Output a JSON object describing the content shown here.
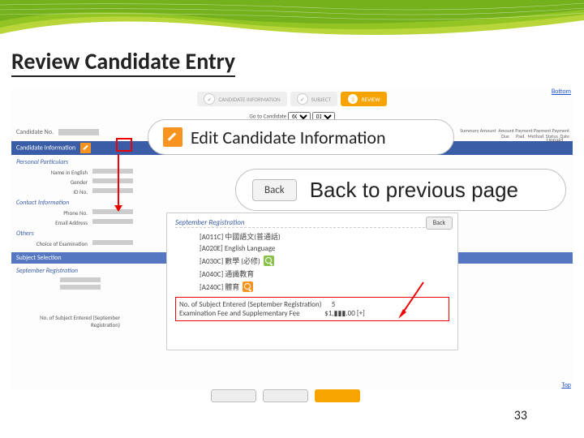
{
  "slide": {
    "title": "Review Candidate Entry",
    "page_number": "33"
  },
  "breadcrumb": {
    "step1": "CANDIDATE INFORMATION",
    "step2": "SUBJECT",
    "step3": "REVIEW"
  },
  "links": {
    "bottom": "Bottom",
    "top": "Top"
  },
  "goto": {
    "label": "Go to Candidate"
  },
  "candidate": {
    "no_label": "Candidate No.",
    "info_bar": "Candidate Information",
    "personal_head": "Personal Particulars",
    "name_label": "Name in English",
    "gender_label": "Gender",
    "id_label": "ID No.",
    "contact_head": "Contact Information",
    "phone_label": "Phone No.",
    "email_label": "Email Address",
    "others_head": "Others",
    "choice_label": "Choice of Examination",
    "status": "Unpaid",
    "subject_bar": "Subject Selection",
    "sep_head": "September Registration",
    "summary_label": "No. of Subject Entered (September Registration)"
  },
  "popup": {
    "back": "Back",
    "header": "September Registration",
    "subjects": [
      "[A011C] 中國語文(普通話)",
      "[A020E] English Language",
      "[A030C] 數學 (必修)",
      "[A040C] 通識教育",
      "[A240C] 體育"
    ],
    "summary_label": "No. of Subject Entered (September Registration)",
    "summary_value": "5",
    "fee_label": "Examination Fee and Supplementary Fee",
    "fee_value": "$1,▮▮▮.00 [+]"
  },
  "callouts": {
    "edit": "Edit Candidate Information",
    "back_btn": "Back",
    "back_text": "Back to previous page"
  },
  "table_hints": {
    "c1": "Summary Amount",
    "c2": "Amount",
    "c3": "Payment",
    "c4": "Payment",
    "c5": "Payment",
    "r1": "Due",
    "r2": "Paid",
    "r3": "Method",
    "r4": "Status",
    "r5": "Date"
  }
}
